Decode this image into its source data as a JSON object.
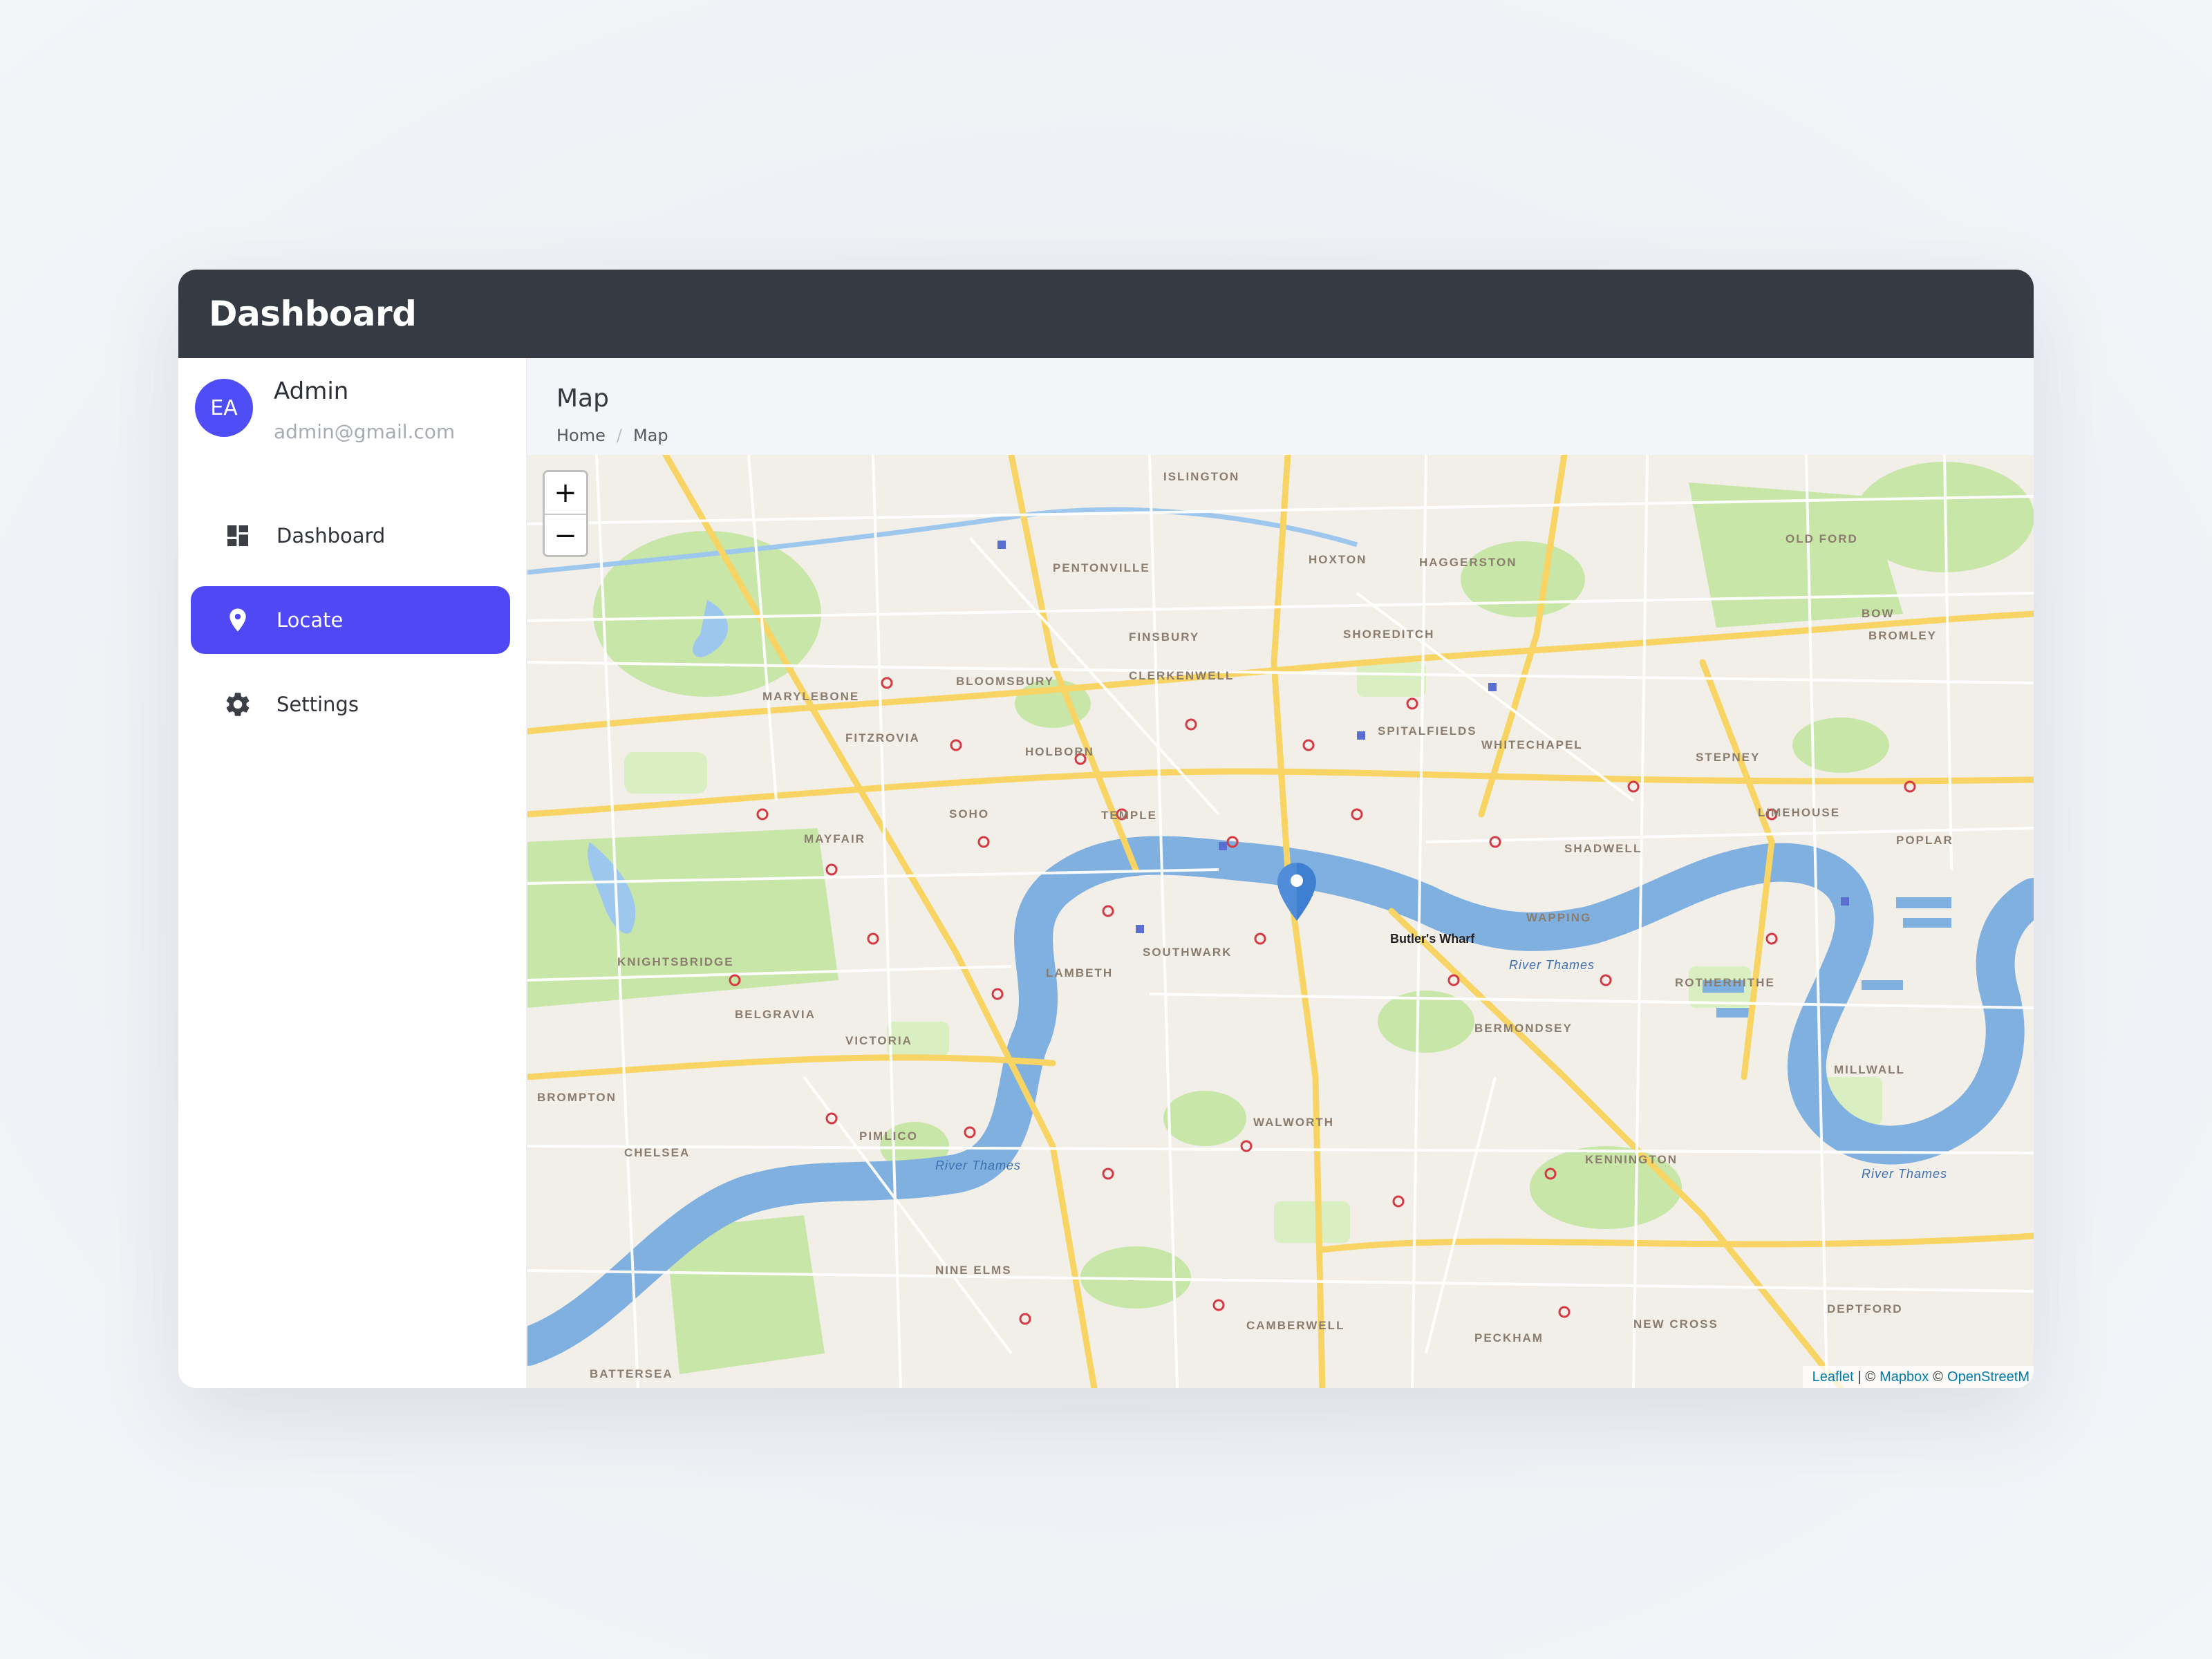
{
  "app": {
    "title": "Dashboard"
  },
  "profile": {
    "initials": "EA",
    "name": "Admin",
    "email": "admin@gmail.com"
  },
  "nav": [
    {
      "label": "Dashboard",
      "icon": "dashboard-icon",
      "active": false
    },
    {
      "label": "Locate",
      "icon": "map-pin-icon",
      "active": true
    },
    {
      "label": "Settings",
      "icon": "gear-icon",
      "active": false
    }
  ],
  "page": {
    "title": "Map",
    "breadcrumb": [
      "Home",
      "Map"
    ]
  },
  "map": {
    "zoom_in": "+",
    "zoom_out": "−",
    "attribution": {
      "leaflet": "Leaflet",
      "sep": "| ©",
      "mapbox": "Mapbox",
      "copy": "©",
      "osm": "OpenStreetM"
    },
    "labels": {
      "river1": "River Thames",
      "river2": "River Thames",
      "river3": "River Thames",
      "poi": "Butler's Wharf",
      "islington": "ISLINGTON",
      "pentonville": "PENTONVILLE",
      "hoxton": "HOXTON",
      "finsbury": "FINSBURY",
      "clerkenwell": "CLERKENWELL",
      "shoreditch": "SHOREDITCH",
      "spitalfields": "SPITALFIELDS",
      "whitechapel": "WHITECHAPEL",
      "marylebone": "MARYLEBONE",
      "fitzrovia": "FITZROVIA",
      "bloomsbury": "BLOOMSBURY",
      "holborn": "HOLBORN",
      "soho": "SOHO",
      "mayfair": "MAYFAIR",
      "temple": "TEMPLE",
      "southwark": "SOUTHWARK",
      "bermondsey": "BERMONDSEY",
      "lambeth": "LAMBETH",
      "belgravia": "BELGRAVIA",
      "knightsbridge": "KNIGHTSBRIDGE",
      "victoria": "VICTORIA",
      "pimlico": "PIMLICO",
      "chelsea": "CHELSEA",
      "walworth": "WALWORTH",
      "camberwell": "CAMBERWELL",
      "peckham": "PECKHAM",
      "wapping": "WAPPING",
      "shadwell": "SHADWELL",
      "limehouse": "LIMEHOUSE",
      "stepney": "STEPNEY",
      "rotherhithe": "ROTHERHITHE",
      "millwall": "MILLWALL",
      "brompton": "BROMPTON",
      "nine_elms": "NINE ELMS",
      "battersea": "BATTERSEA",
      "new_cross": "NEW CROSS",
      "kennington": "KENNINGTON",
      "haggerston": "HAGGERSTON",
      "bow": "BOW",
      "bromley": "BROMLEY",
      "old_ford": "OLD FORD",
      "poplar": "POPLAR",
      "deptford": "DEPTFORD"
    }
  },
  "colors": {
    "accent": "#5048f5",
    "topbar": "#363a42",
    "water": "#7fb0e0",
    "park": "#c8e6a8",
    "marker": "#3f7fcf"
  }
}
